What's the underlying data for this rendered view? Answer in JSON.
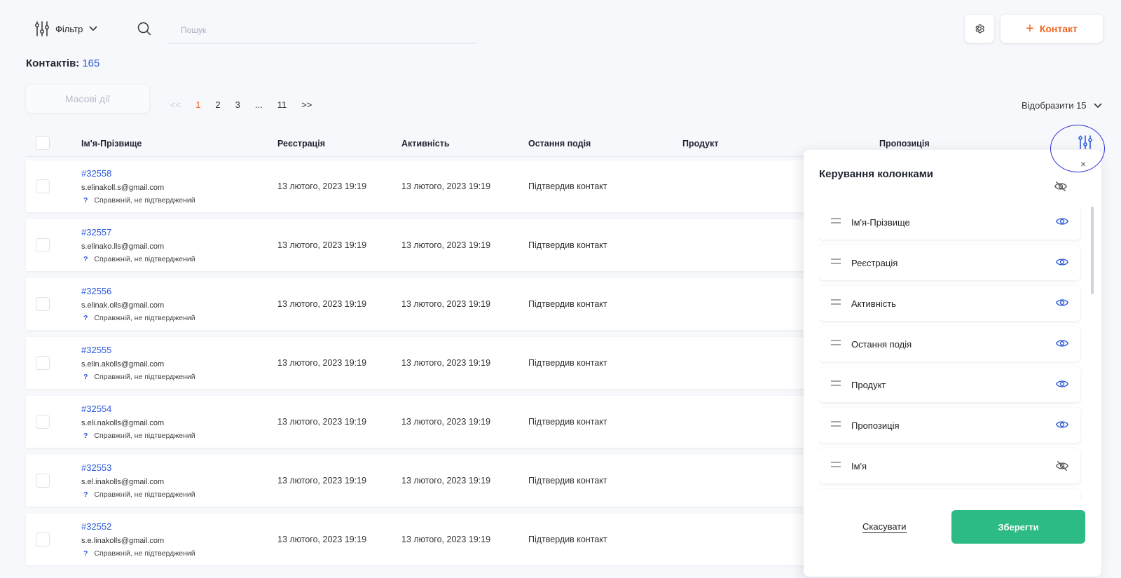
{
  "toolbar": {
    "filter_label": "Фільтр",
    "search_placeholder": "Пошук",
    "add_contact_label": "Контакт"
  },
  "contacts_count": {
    "label": "Контактів:",
    "value": "165"
  },
  "mass_actions_label": "Масові дії",
  "pagination": {
    "prev": "<<",
    "pages": [
      "1",
      "2",
      "3",
      "...",
      "11"
    ],
    "next": ">>",
    "current": "1"
  },
  "per_page_label": "Відобразити 15",
  "table": {
    "headers": [
      "Ім'я-Прізвище",
      "Реєстрація",
      "Активність",
      "Остання подія",
      "Продукт",
      "Пропозиція"
    ],
    "rows": [
      {
        "id": "#32558",
        "email": "s.elinakoll.s@gmail.com",
        "status": "Справжній, не підтверджений",
        "registration": "13 лютого, 2023 19:19",
        "activity": "13 лютого, 2023 19:19",
        "last_event": "Підтвердив контакт"
      },
      {
        "id": "#32557",
        "email": "s.elinako.lls@gmail.com",
        "status": "Справжній, не підтверджений",
        "registration": "13 лютого, 2023 19:19",
        "activity": "13 лютого, 2023 19:19",
        "last_event": "Підтвердив контакт"
      },
      {
        "id": "#32556",
        "email": "s.elinak.olls@gmail.com",
        "status": "Справжній, не підтверджений",
        "registration": "13 лютого, 2023 19:19",
        "activity": "13 лютого, 2023 19:19",
        "last_event": "Підтвердив контакт"
      },
      {
        "id": "#32555",
        "email": "s.elin.akolls@gmail.com",
        "status": "Справжній, не підтверджений",
        "registration": "13 лютого, 2023 19:19",
        "activity": "13 лютого, 2023 19:19",
        "last_event": "Підтвердив контакт"
      },
      {
        "id": "#32554",
        "email": "s.eli.nakolls@gmail.com",
        "status": "Справжній, не підтверджений",
        "registration": "13 лютого, 2023 19:19",
        "activity": "13 лютого, 2023 19:19",
        "last_event": "Підтвердив контакт"
      },
      {
        "id": "#32553",
        "email": "s.el.inakolls@gmail.com",
        "status": "Справжній, не підтверджений",
        "registration": "13 лютого, 2023 19:19",
        "activity": "13 лютого, 2023 19:19",
        "last_event": "Підтвердив контакт"
      },
      {
        "id": "#32552",
        "email": "s.e.linakolls@gmail.com",
        "status": "Справжній, не підтверджений",
        "registration": "13 лютого, 2023 19:19",
        "activity": "13 лютого, 2023 19:19",
        "last_event": "Підтвердив контакт"
      }
    ]
  },
  "column_panel": {
    "title": "Керування колонками",
    "close": "×",
    "columns": [
      {
        "label": "Ім'я-Прізвище",
        "visible": true
      },
      {
        "label": "Реєстрація",
        "visible": true
      },
      {
        "label": "Активність",
        "visible": true
      },
      {
        "label": "Остання подія",
        "visible": true
      },
      {
        "label": "Продукт",
        "visible": true
      },
      {
        "label": "Пропозиція",
        "visible": true
      },
      {
        "label": "Ім'я",
        "visible": false
      }
    ],
    "cancel_label": "Скасувати",
    "save_label": "Зберегти"
  },
  "colors": {
    "accent": "#2b59d9",
    "orange": "#f26522",
    "save_green": "#2cba85",
    "highlight_ring": "#2b2fd6"
  },
  "icons": [
    "filter-sliders-icon",
    "chevron-down-icon",
    "search-icon",
    "gear-icon",
    "plus-icon",
    "column-settings-icon",
    "eye-icon",
    "eye-off-icon",
    "drag-handle-icon",
    "close-icon"
  ]
}
